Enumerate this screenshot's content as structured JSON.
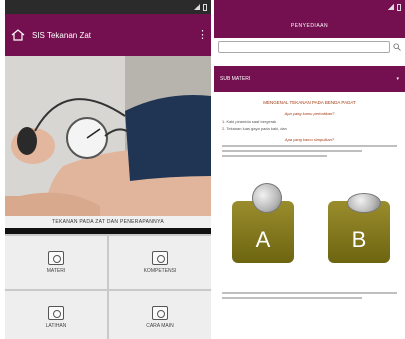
{
  "left": {
    "title": "SIS Tekanan Zat",
    "kebab_icon": "more-vert-icon",
    "home_icon": "home-icon",
    "photo_caption": "TEKANAN PADA ZAT DAN PENERAPANNYA",
    "tiles": [
      {
        "label": "MATERI",
        "icon": "materi-icon"
      },
      {
        "label": "KOMPETENSI",
        "icon": "kompetensi-icon"
      },
      {
        "label": "LATIHAN",
        "icon": "latihan-icon"
      },
      {
        "label": "CARA MAIN",
        "icon": "help-icon"
      }
    ]
  },
  "right": {
    "title": "PENYEDIAAN",
    "search_placeholder": "",
    "menu_label": "SUB MATERI",
    "heading": "MENGENAL TEKANAN PADA BENDA PADAT",
    "q1": "Apa yang kamu perhatikan?",
    "list1": [
      "1. Kaki piramida saat bergerak",
      "2. Tekanan luas gaya pada kaki, dan"
    ],
    "q2": "Apa yang kamu simpulkan?",
    "coin_labels": [
      "A",
      "B"
    ]
  },
  "colors": {
    "brand": "#74104f",
    "cube": "#8b7f1f"
  }
}
